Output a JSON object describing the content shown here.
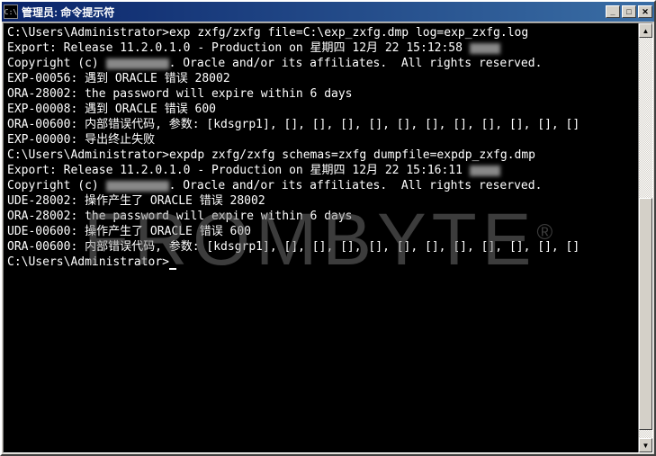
{
  "window": {
    "icon_text": "C:\\",
    "title": "管理员: 命令提示符"
  },
  "terminal": {
    "prompt1": "C:\\Users\\Administrator>",
    "cmd1": "exp zxfg/zxfg file=C:\\exp_zxfg.dmp log=exp_zxfg.log",
    "blank": "",
    "export_header1_a": "Export: Release 11.2.0.1.0 - Production on 星期四 12月 22 15:12:58 ",
    "copyright1_a": "Copyright (c) ",
    "copyright1_b": ". Oracle and/or its affiliates.  All rights reserved.",
    "exp56": "EXP-00056: 遇到 ORACLE 错误 28002",
    "ora28002_1": "ORA-28002: the password will expire within 6 days",
    "exp08": "EXP-00008: 遇到 ORACLE 错误 600",
    "ora600_1": "ORA-00600: 内部错误代码, 参数: [kdsgrp1], [], [], [], [], [], [], [], [], [], [], []",
    "exp00": "EXP-00000: 导出终止失败",
    "prompt2": "C:\\Users\\Administrator>",
    "cmd2": "expdp zxfg/zxfg schemas=zxfg dumpfile=expdp_zxfg.dmp",
    "export_header2_a": "Export: Release 11.2.0.1.0 - Production on 星期四 12月 22 15:16:11 ",
    "copyright2_a": "Copyright (c) ",
    "copyright2_b": ". Oracle and/or its affiliates.  All rights reserved.",
    "ude28002": "UDE-28002: 操作产生了 ORACLE 错误 28002",
    "ora28002_2": "ORA-28002: the password will expire within 6 days",
    "ude600": "UDE-00600: 操作产生了 ORACLE 错误 600",
    "ora600_2": "ORA-00600: 内部错误代码, 参数: [kdsgrp1], [], [], [], [], [], [], [], [], [], [], []",
    "prompt3": "C:\\Users\\Administrator>"
  },
  "watermark": {
    "text": "FROMBYTE",
    "reg": "®"
  }
}
